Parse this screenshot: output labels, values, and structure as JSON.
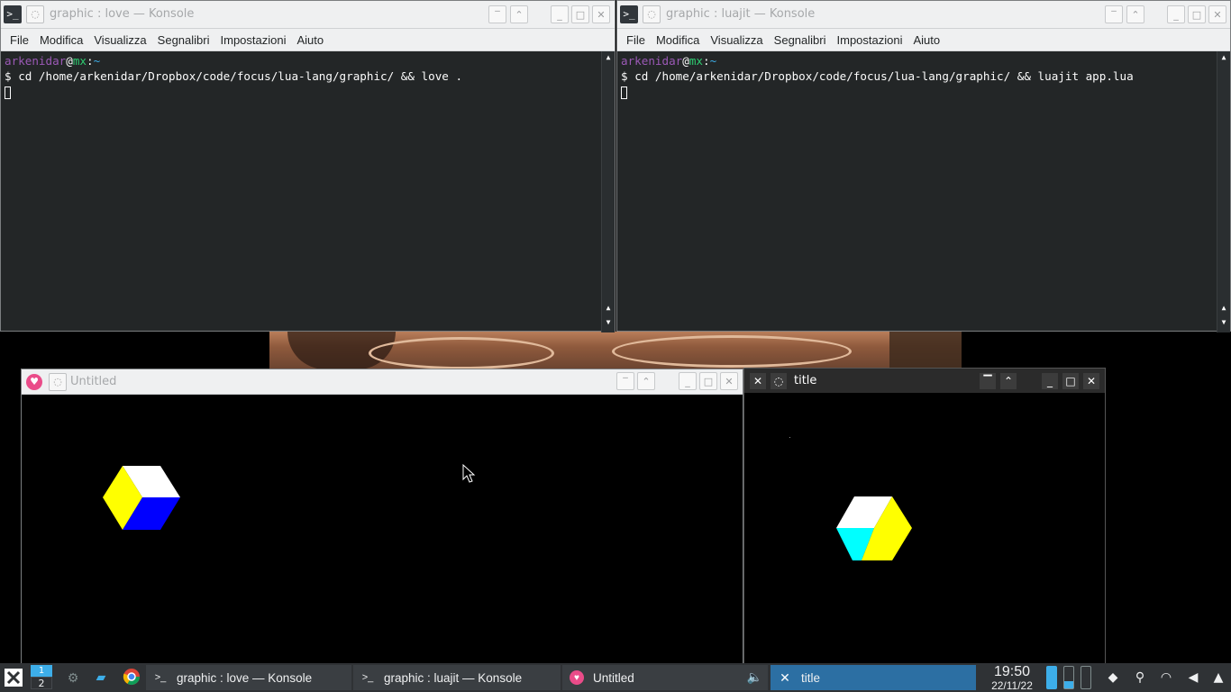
{
  "konsole_left": {
    "title": "graphic : love — Konsole",
    "menu": [
      "File",
      "Modifica",
      "Visualizza",
      "Segnalibri",
      "Impostazioni",
      "Aiuto"
    ],
    "prompt_user": "arkenidar",
    "prompt_at": "@",
    "prompt_host": "mx",
    "prompt_sep": ":",
    "prompt_path": "~",
    "prompt_symbol": "$",
    "command": "cd /home/arkenidar/Dropbox/code/focus/lua-lang/graphic/ && love ."
  },
  "konsole_right": {
    "title": "graphic : luajit — Konsole",
    "menu": [
      "File",
      "Modifica",
      "Visualizza",
      "Segnalibri",
      "Impostazioni",
      "Aiuto"
    ],
    "prompt_user": "arkenidar",
    "prompt_at": "@",
    "prompt_host": "mx",
    "prompt_sep": ":",
    "prompt_path": "~",
    "prompt_symbol": "$",
    "command": "cd /home/arkenidar/Dropbox/code/focus/lua-lang/graphic/ && luajit app.lua"
  },
  "love_window": {
    "title": "Untitled",
    "cube_colors": [
      "#ffffff",
      "#ffff00",
      "#0000ff"
    ]
  },
  "sdl_window": {
    "title": "title",
    "cube_colors": [
      "#ffffff",
      "#00ffff",
      "#ffff00"
    ]
  },
  "taskbar": {
    "pager_top": "1",
    "pager_bottom": "2",
    "tasks": [
      {
        "label": "graphic : love — Konsole",
        "icon": "terminal-icon"
      },
      {
        "label": "graphic : luajit — Konsole",
        "icon": "terminal-icon"
      },
      {
        "label": "Untitled",
        "icon": "love-heart-icon"
      },
      {
        "label": "title",
        "icon": "x-icon"
      }
    ],
    "clock_time": "19:50",
    "clock_date": "22/11/22"
  }
}
